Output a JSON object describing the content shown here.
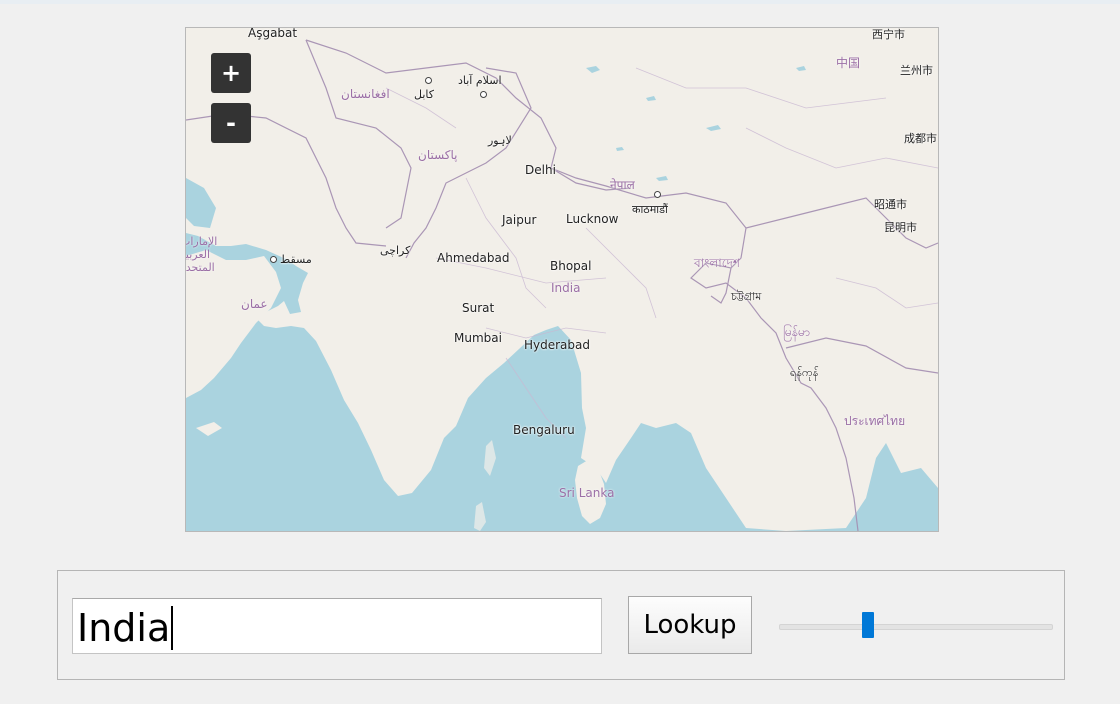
{
  "map": {
    "zoom_in_label": "+",
    "zoom_out_label": "-",
    "water_color": "#aad3df",
    "land_color": "#f2efe9",
    "border_color": "#a38db0",
    "cities": {
      "asgabat": "Aşgabat",
      "kabul": "کابل",
      "islamabad": "اسلام آباد",
      "lahore": "لاہور",
      "delhi": "Delhi",
      "jaipur": "Jaipur",
      "lucknow": "Lucknow",
      "kathmandu": "काठमाडौं",
      "karachi": "کراچی",
      "ahmedabad": "Ahmedabad",
      "bhopal": "Bhopal",
      "surat": "Surat",
      "mumbai": "Mumbai",
      "hyderabad": "Hyderabad",
      "bengaluru": "Bengaluru",
      "muscat": "مسقط",
      "chittagong": "চট্টগ্রাম",
      "yangon": "ရန်ကုန်",
      "xining": "西宁市",
      "lanzhou": "兰州市",
      "chengdu": "成都市",
      "zhaotong": "昭通市",
      "kunming": "昆明市"
    },
    "countries": {
      "afghanistan": "افغانستان",
      "pakistan": "پاکستان",
      "nepal": "नेपाल",
      "india": "India",
      "bangladesh": "বাংলাদেশ",
      "uae": "الإمارات العربية المتحدة",
      "oman": "عمان",
      "myanmar": "မြန်မာ",
      "thailand": "ประเทศไทย",
      "sri_lanka": "Sri Lanka",
      "china": "中国"
    }
  },
  "controls": {
    "search_value": "India",
    "lookup_label": "Lookup",
    "slider_value": 0.32,
    "slider_color": "#0078d7"
  }
}
